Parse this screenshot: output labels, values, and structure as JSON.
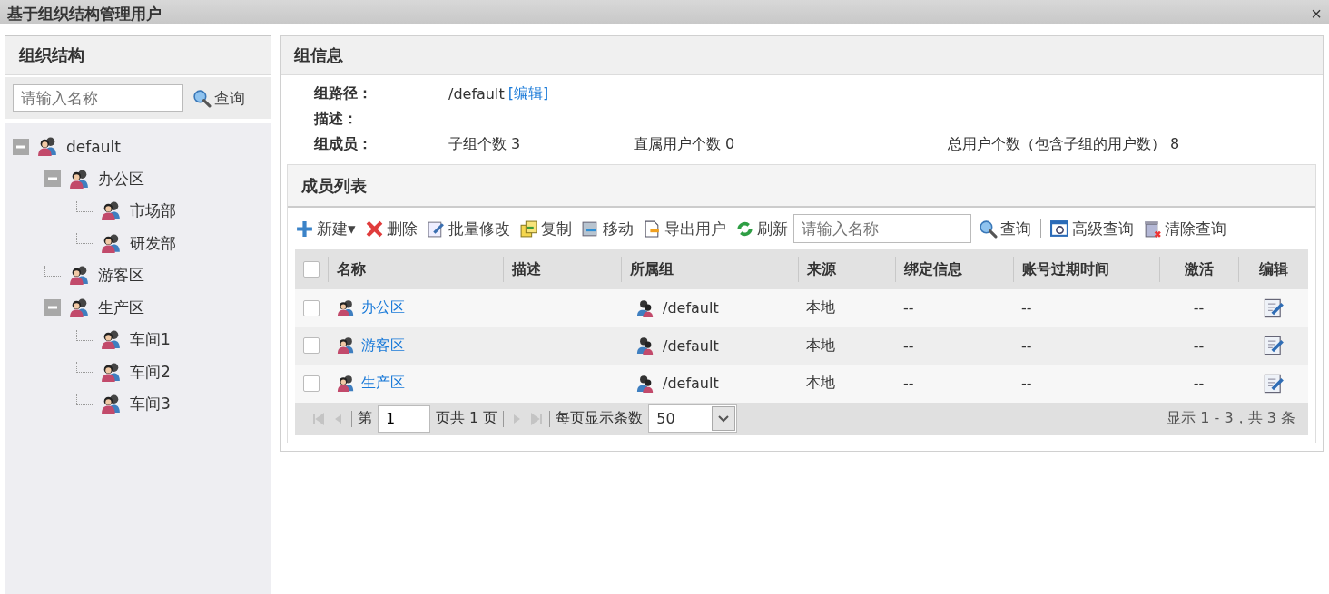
{
  "window": {
    "title": "基于组织结构管理用户",
    "close": "×"
  },
  "sidebar": {
    "title": "组织结构",
    "search": {
      "placeholder": "请输入名称",
      "button": "查询"
    },
    "tree": [
      {
        "label": "default",
        "expanded": true,
        "children": [
          {
            "label": "办公区",
            "expanded": true,
            "children": [
              {
                "label": "市场部"
              },
              {
                "label": "研发部"
              }
            ]
          },
          {
            "label": "游客区"
          },
          {
            "label": "生产区",
            "expanded": true,
            "children": [
              {
                "label": "车间1"
              },
              {
                "label": "车间2"
              },
              {
                "label": "车间3"
              }
            ]
          }
        ]
      }
    ]
  },
  "group_info": {
    "title": "组信息",
    "path_label": "组路径：",
    "path": "/default",
    "edit_link": "[编辑]",
    "desc_label": "描述：",
    "members_label": "组成员：",
    "subgroups": "子组个数 3",
    "direct_users": "直属用户个数 0",
    "total_users": "总用户个数（包含子组的用户数） 8"
  },
  "members": {
    "title": "成员列表",
    "toolbar": [
      {
        "kind": "plus",
        "label": "新建▾"
      },
      {
        "kind": "delete",
        "label": "删除"
      },
      {
        "kind": "edit",
        "label": "批量修改"
      },
      {
        "kind": "copy",
        "label": "复制"
      },
      {
        "kind": "move",
        "label": "移动"
      },
      {
        "kind": "export",
        "label": "导出用户"
      },
      {
        "kind": "refresh",
        "label": "刷新"
      }
    ],
    "search": {
      "placeholder": "请输入名称",
      "button": "查询",
      "advanced": "高级查询",
      "clear": "清除查询"
    },
    "select_all_checked": false,
    "columns": [
      "名称",
      "描述",
      "所属组",
      "来源",
      "绑定信息",
      "账号过期时间",
      "激活",
      "编辑"
    ],
    "rows": [
      {
        "checked": false,
        "name": "办公区",
        "group": "/default",
        "source": "本地",
        "binding": "--",
        "expiry": "--",
        "active": "--"
      },
      {
        "checked": false,
        "name": "游客区",
        "group": "/default",
        "source": "本地",
        "binding": "--",
        "expiry": "--",
        "active": "--"
      },
      {
        "checked": false,
        "name": "生产区",
        "group": "/default",
        "source": "本地",
        "binding": "--",
        "expiry": "--",
        "active": "--"
      }
    ],
    "pager": {
      "page_prefix": "第",
      "page": "1",
      "page_suffix": "页共 1 页",
      "per_page_label": "每页显示条数",
      "per_page": "50",
      "summary": "显示 1 - 3，共 3 条"
    }
  }
}
